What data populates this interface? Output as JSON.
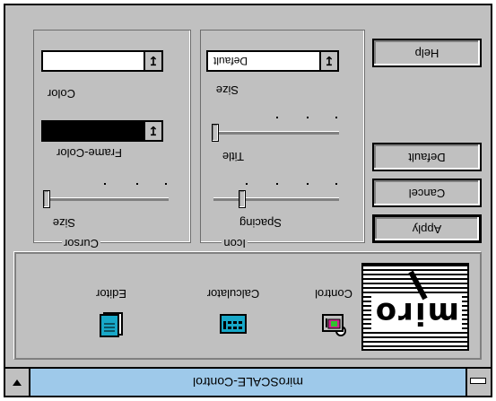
{
  "window": {
    "title": "miroSCALE-Control"
  },
  "cursor_group": {
    "label": "Cursor",
    "color_label": "Color",
    "frame_color_label": "Frame-Color",
    "size_label": "Size",
    "color_value": "",
    "frame_color_value": ""
  },
  "icon_group": {
    "label": "Icon",
    "size_label": "Size",
    "size_value": "Default",
    "title_label": "Title",
    "spacing_label": "Spacing"
  },
  "buttons": {
    "help": "Help",
    "default": "Default",
    "cancel": "Cancel",
    "apply": "Apply"
  },
  "tools": {
    "logo_text": "miro",
    "editor": "Editor",
    "calculator": "Calculator",
    "control": "Control"
  },
  "colors": {
    "title_bar": "#9ec9ea",
    "face": "#c0c0c0"
  }
}
